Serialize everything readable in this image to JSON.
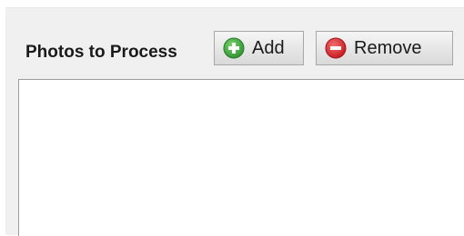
{
  "header": {
    "title": "Photos to Process"
  },
  "buttons": {
    "add_label": "Add",
    "remove_label": "Remove"
  },
  "icons": {
    "add": "plus-circle-green",
    "remove": "minus-circle-red"
  },
  "colors": {
    "add_icon": "#35a63a",
    "remove_icon": "#d8232a"
  },
  "photos_list": {
    "items": []
  }
}
